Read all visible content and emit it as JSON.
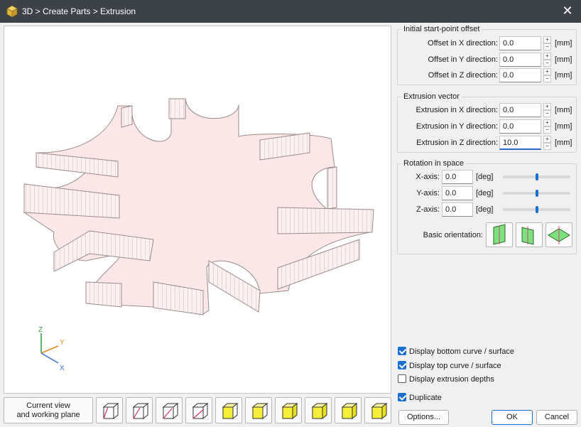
{
  "window": {
    "title": "3D > Create Parts > Extrusion"
  },
  "offset": {
    "title": "Initial start-point offset",
    "rows": [
      {
        "label": "Offset in X direction:",
        "value": "0.0",
        "unit": "[mm]"
      },
      {
        "label": "Offset in Y direction:",
        "value": "0.0",
        "unit": "[mm]"
      },
      {
        "label": "Offset in Z direction:",
        "value": "0.0",
        "unit": "[mm]"
      }
    ]
  },
  "extrusion": {
    "title": "Extrusion vector",
    "rows": [
      {
        "label": "Extrusion in X direction:",
        "value": "0.0",
        "unit": "[mm]"
      },
      {
        "label": "Extrusion in Y direction:",
        "value": "0.0",
        "unit": "[mm]"
      },
      {
        "label": "Extrusion in Z direction:",
        "value": "10.0",
        "unit": "[mm]"
      }
    ]
  },
  "rotation": {
    "title": "Rotation in space",
    "rows": [
      {
        "label": "X-axis:",
        "value": "0.0",
        "unit": "[deg]",
        "slider": 0.5
      },
      {
        "label": "Y-axis:",
        "value": "0.0",
        "unit": "[deg]",
        "slider": 0.5
      },
      {
        "label": "Z-axis:",
        "value": "0.0",
        "unit": "[deg]",
        "slider": 0.5
      }
    ],
    "basic_orientation_label": "Basic orientation:"
  },
  "options": {
    "display_bottom": {
      "label": "Display bottom curve / surface",
      "checked": true
    },
    "display_top": {
      "label": "Display top curve / surface",
      "checked": true
    },
    "display_depths": {
      "label": "Display extrusion depths",
      "checked": false
    },
    "duplicate": {
      "label": "Duplicate",
      "checked": true
    }
  },
  "toolbar": {
    "current_view_label_1": "Current view",
    "current_view_label_2": "and working plane"
  },
  "axes": {
    "x": "X",
    "y": "Y",
    "z": "Z"
  },
  "buttons": {
    "options": "Options...",
    "ok": "OK",
    "cancel": "Cancel"
  },
  "colors": {
    "accent": "#1a6fd0",
    "titlebar": "#3c4248",
    "part_fill": "#fbe7e7",
    "part_edge": "#9a8c8c"
  }
}
